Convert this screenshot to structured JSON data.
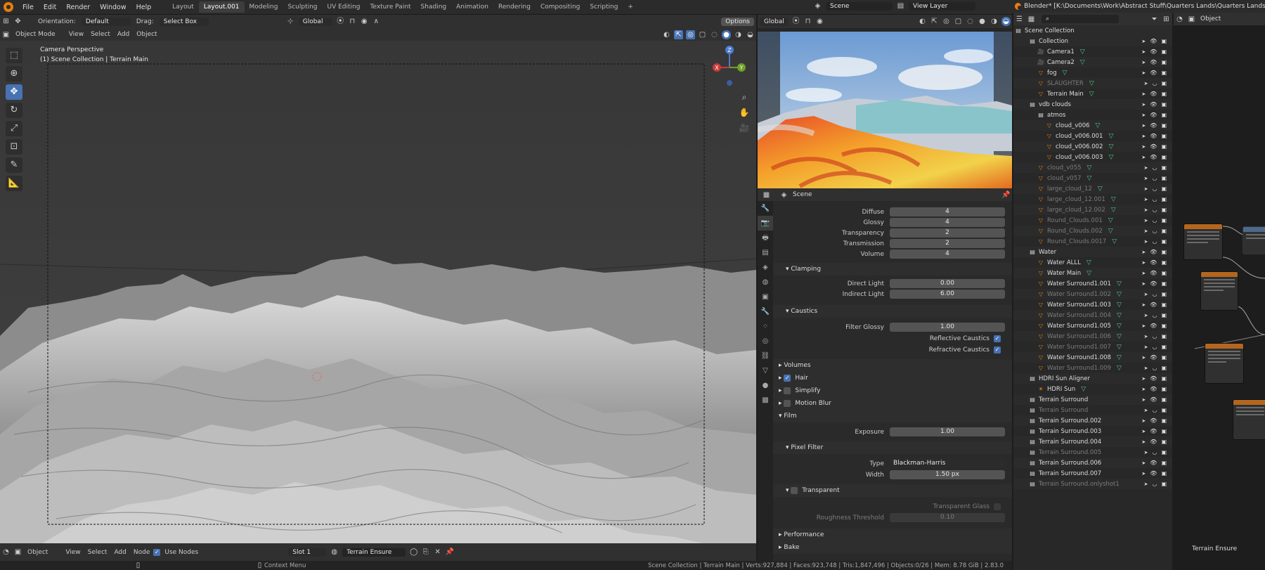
{
  "menu": [
    "File",
    "Edit",
    "Render",
    "Window",
    "Help"
  ],
  "workspaces": [
    "Layout",
    "Layout.001",
    "Modeling",
    "Sculpting",
    "UV Editing",
    "Texture Paint",
    "Shading",
    "Animation",
    "Rendering",
    "Compositing",
    "Scripting"
  ],
  "active_workspace": "Layout.001",
  "scene_name": "Scene",
  "view_layer": "View Layer",
  "window_title": "Blender* [K:\\Documents\\Work\\Abstract Stuff\\Quarters Lands\\Quarters Lands.blend]",
  "viewport": {
    "orientation_label": "Orientation:",
    "orientation": "Default",
    "drag_label": "Drag:",
    "drag": "Select Box",
    "transform": "Global",
    "options": "Options",
    "mode": "Object Mode",
    "menus": [
      "View",
      "Select",
      "Add",
      "Object"
    ],
    "camera_line1": "Camera Perspective",
    "camera_line2": "(1) Scene Collection | Terrain Main"
  },
  "right_header": {
    "transform": "Global"
  },
  "properties": {
    "context": "Scene",
    "light_paths": [
      {
        "k": "Diffuse",
        "v": "4"
      },
      {
        "k": "Glossy",
        "v": "4"
      },
      {
        "k": "Transparency",
        "v": "2"
      },
      {
        "k": "Transmission",
        "v": "2"
      },
      {
        "k": "Volume",
        "v": "4"
      }
    ],
    "clamping": "Clamping",
    "direct_light_k": "Direct Light",
    "direct_light_v": "0.00",
    "indirect_light_k": "Indirect Light",
    "indirect_light_v": "6.00",
    "caustics": "Caustics",
    "filter_glossy_k": "Filter Glossy",
    "filter_glossy_v": "1.00",
    "reflective_caustics": "Reflective Caustics",
    "refractive_caustics": "Refractive Caustics",
    "volumes": "Volumes",
    "hair": "Hair",
    "simplify": "Simplify",
    "motion_blur": "Motion Blur",
    "film": "Film",
    "exposure_k": "Exposure",
    "exposure_v": "1.00",
    "pixel_filter": "Pixel Filter",
    "type_k": "Type",
    "type_v": "Blackman-Harris",
    "width_k": "Width",
    "width_v": "1.50 px",
    "transparent": "Transparent",
    "transparent_glass": "Transparent Glass",
    "roughness_threshold_k": "Roughness Threshold",
    "roughness_threshold_v": "0.10",
    "performance": "Performance",
    "bake": "Bake"
  },
  "outliner": {
    "root": "Scene Collection",
    "rows": [
      {
        "name": "Collection",
        "dim": false,
        "kind": "coll"
      },
      {
        "name": "Camera1",
        "dim": false,
        "kind": "cam"
      },
      {
        "name": "Camera2",
        "dim": false,
        "kind": "cam"
      },
      {
        "name": "fog",
        "dim": false,
        "kind": "obj"
      },
      {
        "name": "SLAUGHTER",
        "dim": true,
        "kind": "obj"
      },
      {
        "name": "Terrain Main",
        "dim": false,
        "kind": "obj"
      },
      {
        "name": "vdb clouds",
        "dim": false,
        "kind": "coll"
      },
      {
        "name": "atmos",
        "dim": false,
        "kind": "coll"
      },
      {
        "name": "cloud_v006",
        "dim": false,
        "kind": "obj"
      },
      {
        "name": "cloud_v006.001",
        "dim": false,
        "kind": "obj"
      },
      {
        "name": "cloud_v006.002",
        "dim": false,
        "kind": "obj"
      },
      {
        "name": "cloud_v006.003",
        "dim": false,
        "kind": "obj"
      },
      {
        "name": "cloud_v055",
        "dim": true,
        "kind": "obj"
      },
      {
        "name": "cloud_v057",
        "dim": true,
        "kind": "obj"
      },
      {
        "name": "large_cloud_12",
        "dim": true,
        "kind": "obj"
      },
      {
        "name": "large_cloud_12.001",
        "dim": true,
        "kind": "obj"
      },
      {
        "name": "large_cloud_12.002",
        "dim": true,
        "kind": "obj"
      },
      {
        "name": "Round_Clouds.001",
        "dim": true,
        "kind": "obj"
      },
      {
        "name": "Round_Clouds.002",
        "dim": true,
        "kind": "obj"
      },
      {
        "name": "Round_Clouds.0017",
        "dim": true,
        "kind": "obj"
      },
      {
        "name": "Water",
        "dim": false,
        "kind": "coll"
      },
      {
        "name": "Water ALLL",
        "dim": false,
        "kind": "obj"
      },
      {
        "name": "Water Main",
        "dim": false,
        "kind": "obj"
      },
      {
        "name": "Water Surround1.001",
        "dim": false,
        "kind": "obj"
      },
      {
        "name": "Water Surround1.002",
        "dim": true,
        "kind": "obj"
      },
      {
        "name": "Water Surround1.003",
        "dim": false,
        "kind": "obj"
      },
      {
        "name": "Water Surround1.004",
        "dim": true,
        "kind": "obj"
      },
      {
        "name": "Water Surround1.005",
        "dim": false,
        "kind": "obj"
      },
      {
        "name": "Water Surround1.006",
        "dim": true,
        "kind": "obj"
      },
      {
        "name": "Water Surround1.007",
        "dim": true,
        "kind": "obj"
      },
      {
        "name": "Water Surround1.008",
        "dim": false,
        "kind": "obj"
      },
      {
        "name": "Water Surround1.009",
        "dim": true,
        "kind": "obj"
      },
      {
        "name": "HDRI Sun Aligner",
        "dim": false,
        "kind": "coll"
      },
      {
        "name": "HDRI Sun",
        "dim": false,
        "kind": "light"
      },
      {
        "name": "Terrain Surround",
        "dim": false,
        "kind": "coll"
      },
      {
        "name": "Terrain Surround",
        "dim": true,
        "kind": "coll"
      },
      {
        "name": "Terrain Surround.002",
        "dim": false,
        "kind": "coll"
      },
      {
        "name": "Terrain Surround.003",
        "dim": false,
        "kind": "coll"
      },
      {
        "name": "Terrain Surround.004",
        "dim": false,
        "kind": "coll"
      },
      {
        "name": "Terrain Surround.005",
        "dim": true,
        "kind": "coll"
      },
      {
        "name": "Terrain Surround.006",
        "dim": false,
        "kind": "coll"
      },
      {
        "name": "Terrain Surround.007",
        "dim": false,
        "kind": "coll"
      },
      {
        "name": "Terrain Surround.onlyshot1",
        "dim": true,
        "kind": "coll"
      }
    ]
  },
  "node_editor": {
    "header": "Object",
    "label": "Terrain Ensure"
  },
  "bottom": {
    "mode": "Object",
    "menus": [
      "View",
      "Select",
      "Add",
      "Node"
    ],
    "use_nodes": "Use Nodes",
    "slot": "Slot 1",
    "material": "Terrain Ensure"
  },
  "status": {
    "context_menu": "Context Menu",
    "stats": "Scene Collection | Terrain Main | Verts:927,884 | Faces:923,748 | Tris:1,847,496 | Objects:0/26 | Mem: 8.78 GiB | 2.83.0"
  },
  "colors": {
    "accent": "#4772b3",
    "orange": "#e87d0d",
    "panel": "#2a2a2a"
  }
}
